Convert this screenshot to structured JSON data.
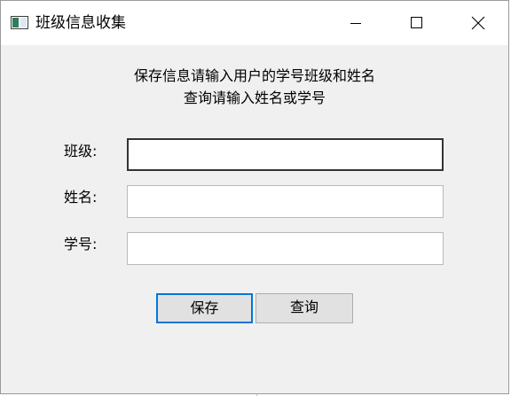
{
  "window": {
    "title": "班级信息收集",
    "controls": {
      "minimize": "minimize-icon",
      "maximize": "maximize-icon",
      "close": "close-icon"
    }
  },
  "instructions": {
    "line1": "保存信息请输入用户的学号班级和姓名",
    "line2": "查询请输入姓名或学号"
  },
  "form": {
    "class_label": "班级:",
    "class_value": "",
    "name_label": "姓名:",
    "name_value": "",
    "id_label": "学号:",
    "id_value": ""
  },
  "buttons": {
    "save_label": "保存",
    "query_label": "查询"
  },
  "colors": {
    "window_bg": "#f0f0f0",
    "titlebar_bg": "#ffffff",
    "focus_accent": "#0078d7",
    "button_bg": "#e1e1e1"
  }
}
